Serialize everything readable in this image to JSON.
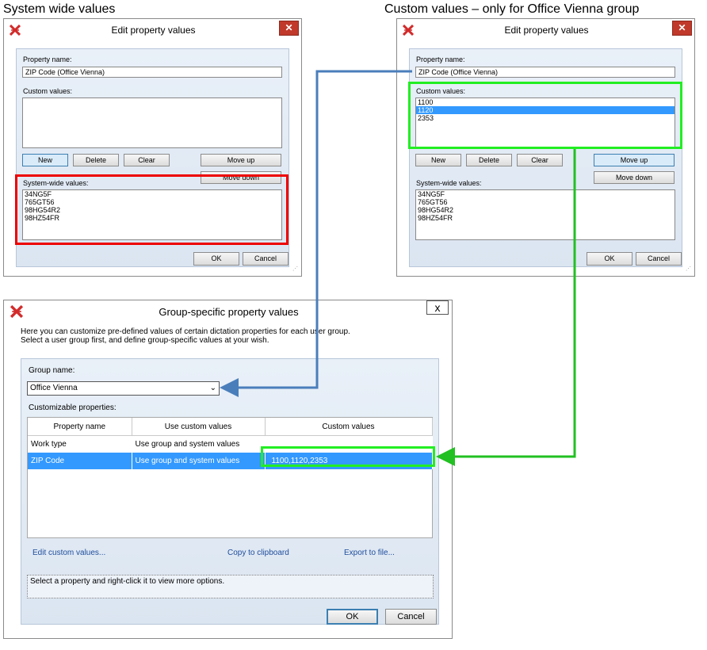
{
  "captions": {
    "left": "System wide values",
    "right": "Custom values – only for Office Vienna group"
  },
  "edit_dialog_left": {
    "title": "Edit property values",
    "property_name_label": "Property name:",
    "property_name_value": "ZIP Code (Office Vienna)",
    "custom_values_label": "Custom values:",
    "custom_values": [],
    "buttons": {
      "new": "New",
      "delete": "Delete",
      "clear": "Clear",
      "move_up": "Move up",
      "move_down": "Move down",
      "ok": "OK",
      "cancel": "Cancel"
    },
    "system_values_label": "System-wide values:",
    "system_values": [
      "34NG5F",
      "765GT56",
      "98HG54R2",
      "98HZ54FR"
    ]
  },
  "edit_dialog_right": {
    "title": "Edit property values",
    "property_name_label": "Property name:",
    "property_name_value": "ZIP Code (Office Vienna)",
    "custom_values_label": "Custom values:",
    "custom_values": [
      "1100",
      "1120",
      "2353"
    ],
    "selected_custom_value": "1120",
    "buttons": {
      "new": "New",
      "delete": "Delete",
      "clear": "Clear",
      "move_up": "Move up",
      "move_down": "Move down",
      "ok": "OK",
      "cancel": "Cancel"
    },
    "system_values_label": "System-wide values:",
    "system_values": [
      "34NG5F",
      "765GT56",
      "98HG54R2",
      "98HZ54FR"
    ]
  },
  "group_dialog": {
    "title": "Group-specific property values",
    "close_label": "x",
    "description_line1": "Here you can customize pre-defined values of certain dictation properties for each user group.",
    "description_line2": "Select a user group first, and define group-specific values at your wish.",
    "group_name_label": "Group name:",
    "group_name_value": "Office Vienna",
    "customizable_label": "Customizable properties:",
    "columns": [
      "Property name",
      "Use custom values",
      "Custom values"
    ],
    "rows": [
      {
        "property": "Work type",
        "use_custom": "Use group and system values",
        "custom_values": ""
      },
      {
        "property": "ZIP Code",
        "use_custom": "Use group and system values",
        "custom_values": "1100,1120,2353"
      }
    ],
    "links": {
      "edit": "Edit custom values...",
      "copy": "Copy to clipboard",
      "export": "Export to file..."
    },
    "status_text": "Select a property and right-click it to view more options.",
    "buttons": {
      "ok": "OK",
      "cancel": "Cancel"
    }
  },
  "colors": {
    "highlight_red": "#ee0000",
    "highlight_green": "#22ee22",
    "connector_blue": "#4a7ebb",
    "connector_green": "#22c022",
    "selection_blue": "#3399ff",
    "logo_red": "#d22b2b"
  }
}
